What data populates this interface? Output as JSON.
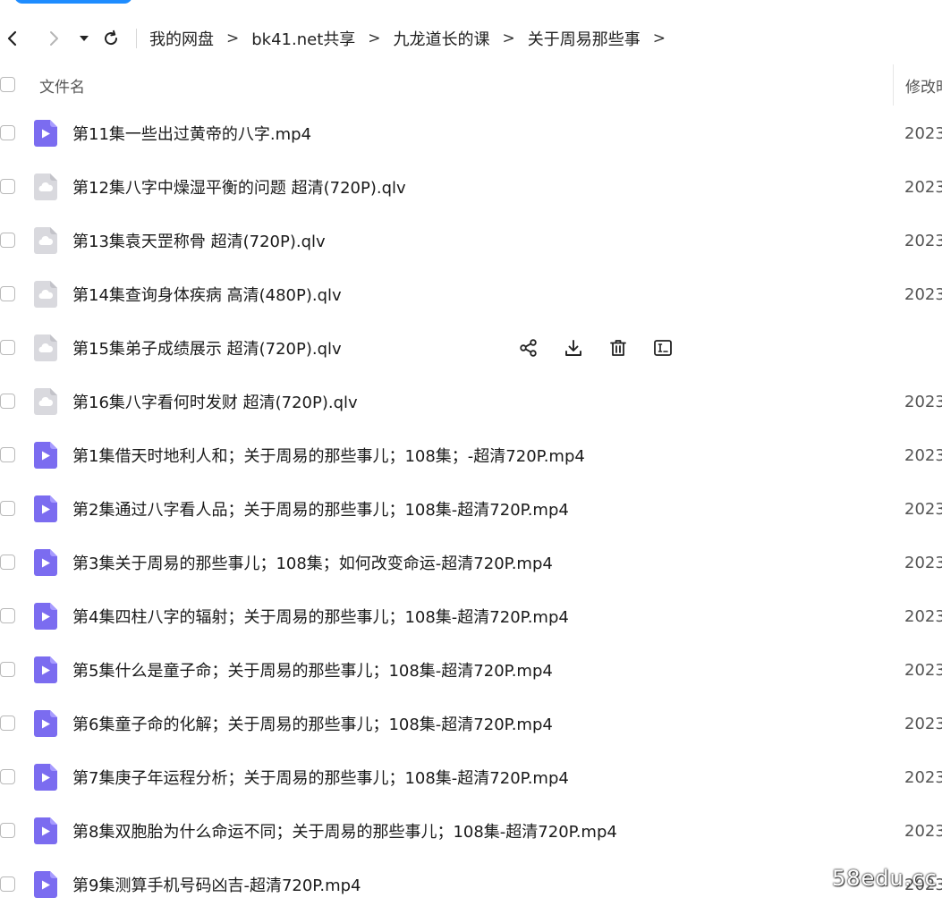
{
  "navigation": {
    "breadcrumbs": [
      {
        "label": "我的网盘"
      },
      {
        "label": "bk41.net共享"
      },
      {
        "label": "九龙道长的课"
      },
      {
        "label": "关于周易那些事"
      }
    ],
    "separator": ">"
  },
  "table": {
    "headers": {
      "name": "文件名",
      "modified": "修改时"
    },
    "rows": [
      {
        "name": "第11集一些出过黄帝的八字.mp4",
        "type": "video",
        "date": "2023"
      },
      {
        "name": "第12集八字中燥湿平衡的问题 超清(720P).qlv",
        "type": "cloud",
        "date": "2023"
      },
      {
        "name": "第13集袁天罡称骨 超清(720P).qlv",
        "type": "cloud",
        "date": "2023"
      },
      {
        "name": "第14集查询身体疾病 高清(480P).qlv",
        "type": "cloud",
        "date": "2023"
      },
      {
        "name": "第15集弟子成绩展示 超清(720P).qlv",
        "type": "cloud",
        "date": ""
      },
      {
        "name": "第16集八字看何时发财 超清(720P).qlv",
        "type": "cloud",
        "date": "2023"
      },
      {
        "name": "第1集借天时地利人和；关于周易的那些事儿；108集；-超清720P.mp4",
        "type": "video",
        "date": "2023"
      },
      {
        "name": "第2集通过八字看人品；关于周易的那些事儿；108集-超清720P.mp4",
        "type": "video",
        "date": "2023"
      },
      {
        "name": "第3集关于周易的那些事儿；108集；如何改变命运-超清720P.mp4",
        "type": "video",
        "date": "2023"
      },
      {
        "name": "第4集四柱八字的辐射；关于周易的那些事儿；108集-超清720P.mp4",
        "type": "video",
        "date": "2023"
      },
      {
        "name": "第5集什么是童子命；关于周易的那些事儿；108集-超清720P.mp4",
        "type": "video",
        "date": "2023"
      },
      {
        "name": "第6集童子命的化解；关于周易的那些事儿；108集-超清720P.mp4",
        "type": "video",
        "date": "2023"
      },
      {
        "name": "第7集庚子年运程分析；关于周易的那些事儿；108集-超清720P.mp4",
        "type": "video",
        "date": "2023"
      },
      {
        "name": "第8集双胞胎为什么命运不同；关于周易的那些事儿；108集-超清720P.mp4",
        "type": "video",
        "date": "2023"
      },
      {
        "name": "第9集测算手机号码凶吉-超清720P.mp4",
        "type": "video",
        "date": "2023"
      }
    ],
    "hover_row_index": 4,
    "hover_actions": [
      "share-icon",
      "download-icon",
      "delete-icon",
      "rename-icon"
    ]
  },
  "watermark": "58edu.cc",
  "colors": {
    "accent": "#1e8cff",
    "video_icon": "#7b6cf0",
    "cloud_icon": "#d9d9de"
  }
}
